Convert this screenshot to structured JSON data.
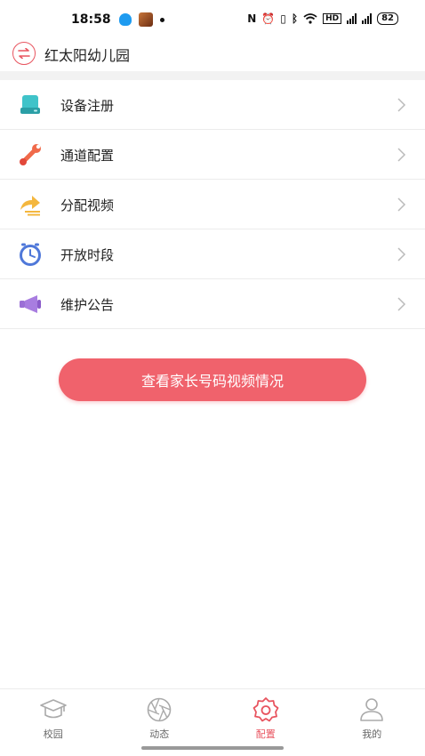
{
  "status_bar": {
    "time": "18:58",
    "battery": "82",
    "nfc": "N",
    "hd": "HD",
    "net1": "4G",
    "net2": "5G"
  },
  "header": {
    "title": "红太阳幼儿园",
    "accent_color": "#e8545f"
  },
  "menu": {
    "items": [
      {
        "label": "设备注册",
        "icon": "device-register-icon"
      },
      {
        "label": "通道配置",
        "icon": "wrench-icon"
      },
      {
        "label": "分配视频",
        "icon": "share-icon"
      },
      {
        "label": "开放时段",
        "icon": "clock-icon"
      },
      {
        "label": "维护公告",
        "icon": "megaphone-icon"
      }
    ]
  },
  "action_button": {
    "label": "查看家长号码视频情况",
    "color": "#f0626c"
  },
  "bottom_nav": {
    "items": [
      {
        "label": "校园",
        "icon": "graduation-cap-icon",
        "active": false
      },
      {
        "label": "动态",
        "icon": "aperture-icon",
        "active": false
      },
      {
        "label": "配置",
        "icon": "gear-icon",
        "active": true
      },
      {
        "label": "我的",
        "icon": "person-icon",
        "active": false
      }
    ],
    "active_color": "#e8545f",
    "inactive_color": "#aaaaaa"
  }
}
